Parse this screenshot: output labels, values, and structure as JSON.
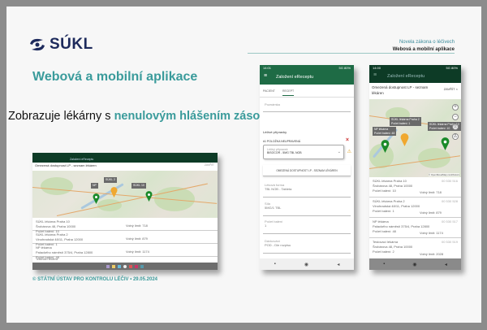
{
  "logo": {
    "text": "SÚKL"
  },
  "slide": {
    "title": "Webová a mobilní aplikace",
    "subtitle_plain": "Zobrazuje lékárny s ",
    "subtitle_highlight": "nenulovým hlášením zásob",
    "header_line1": "Novela zákona o léčivech",
    "header_line2": "Webová a mobilní aplikace",
    "footer": "© STÁTNÍ ÚSTAV PRO KONTROLU LÉČIV • 29.05.2024"
  },
  "web": {
    "tab": "Založení eReceptu",
    "panel_title": "Omezená dostupnost LP - seznam lékáren",
    "close": "ZAVŘÍT",
    "list": [
      {
        "name": "SÚKL lékárna Praha 10",
        "addr": "Šrobárova 48, Praha 10000",
        "left": "Počet balení: 10",
        "right": "Volný limit: 718"
      },
      {
        "name": "SÚKL lékárna Praha 2",
        "addr": "Vinohradská 48/11, Praha 12000",
        "left": "Počet balení: 1",
        "right": "Volný limit: 879"
      },
      {
        "name": "NP lékárna",
        "addr": "Palackého náměstí 375/4, Praha 12800",
        "left": "Počet balení: 48",
        "right": "Volný limit: 1174"
      }
    ],
    "more": "Testovací lékárna"
  },
  "phone1": {
    "status": "14:01",
    "status_right": "5G 80%",
    "app_title": "Založení eReceptu",
    "tabs": [
      "PACIENT",
      "RECEPT",
      "",
      "",
      ""
    ],
    "note_placeholder": "Poznámka",
    "section": "Léčivé přípravky",
    "item_label": "#1 POLOŽKA NEUPRAVENÁ",
    "select_label": "Léčivý přípravek",
    "select_value": "BISOCOR - 5MG TBL NOB",
    "button": "OMEZENÁ DOSTUPNOST LP - SEZNAM LÉKÁREN",
    "fields": [
      {
        "label": "Léková forma",
        "value": "TBL NOB - Tableta"
      },
      {
        "label": "Síla",
        "value": "5MG/1 TBL"
      },
      {
        "label": "Počet balení",
        "value": "1"
      },
      {
        "label": "Dávkování",
        "value": "POD - Dle rozpisu"
      }
    ]
  },
  "phone2": {
    "status": "14:00",
    "status_right": "5G 80%",
    "app_title": "Založení eReceptu",
    "panel_title": "Omezená dostupnost LP - seznam lékáren",
    "close": "ZAVŘÍT ×",
    "map_labels": [
      "NP lékárna",
      "SÚKL lékárna Praha 2",
      "SÚKL lékárna Praha 10"
    ],
    "map_sublabels": [
      "Počet balení: 48",
      "Počet balení: 1",
      "Počet balení: 10"
    ],
    "attribution": "© OpenStreetMap contributors",
    "list": [
      {
        "name": "SÚKL lékárna Praha 10",
        "addr": "Šrobárova 48, Praha 10000",
        "left": "Počet balení: 10",
        "right": "Volný limit: 718",
        "code": "00 530 516"
      },
      {
        "name": "SÚKL lékárna Praha 2",
        "addr": "Vinohradská 48/11, Praha 12000",
        "left": "Počet balení: 1",
        "right": "Volný limit: 879",
        "code": "00 530 528"
      },
      {
        "name": "NP lékárna",
        "addr": "Palackého náměstí 375/4, Praha 12800",
        "left": "Počet balení: 48",
        "right": "Volný limit: 1174",
        "code": "00 530 517"
      },
      {
        "name": "Testovací lékárna",
        "addr": "Šrobárova 48, Praha 10000",
        "left": "Počet balení: 2",
        "right": "Volný limit: 2028",
        "code": "00 530 519"
      }
    ]
  },
  "colors": {
    "teal": "#3a9b9b",
    "green": "#1e6b45",
    "dark_green": "#0d3b26",
    "pin_green": "#1a8a2a",
    "pin_orange": "#f0a830"
  }
}
